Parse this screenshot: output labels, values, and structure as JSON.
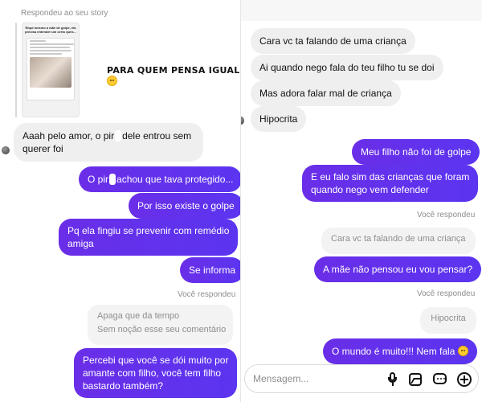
{
  "left": {
    "story_reply_label": "Respondeu ao seu story",
    "story_caption": "Riqui mesmo a mãe de golpe, ela precisa entender um certo ques...",
    "story_overlay_text": "PARA QUEM PENSA IGUAL",
    "messages": [
      {
        "id": "m1",
        "side": "in",
        "parts": [
          "Aaah pelo amor, o pir",
          "dele entrou sem",
          "querer foi"
        ]
      },
      {
        "id": "m2",
        "side": "out",
        "parts": [
          "O pir",
          "achou que tava protegido..."
        ]
      },
      {
        "id": "m3",
        "side": "out",
        "text": "Por isso existe o golpe"
      },
      {
        "id": "m4",
        "side": "out",
        "lines": [
          "Pq ela fingiu se prevenir com remédio",
          "amiga"
        ]
      },
      {
        "id": "m5",
        "side": "out",
        "text": "Se informa"
      }
    ],
    "you_replied_label": "Você respondeu",
    "quoted_reply": {
      "lines": [
        "Apaga que da tempo",
        "Sem noção esse seu comentário"
      ]
    },
    "last_message": {
      "lines": [
        "Percebi que você se dói muito por",
        "amante com filho, você tem filho",
        "bastardo também?"
      ]
    }
  },
  "right": {
    "incoming": [
      "Cara vc ta falando de uma criança",
      "Ai quando nego fala do teu filho tu se doi",
      "Mas adora falar mal de criança",
      "Hipocrita"
    ],
    "outgoing_1": "Meu filho não foi de golpe",
    "outgoing_2": [
      "E eu falo sim das crianças que foram",
      "quando nego vem defender"
    ],
    "you_replied_label_1": "Você respondeu",
    "quoted_1": "Cara vc ta falando de uma criança",
    "outgoing_3": "A mãe não pensou eu vou pensar?",
    "you_replied_label_2": "Você respondeu",
    "quoted_2": "Hipocrita",
    "outgoing_4": "O mundo é muito!!! Nem fala",
    "composer_placeholder": "Mensagem...",
    "icons": [
      "microphone-icon",
      "image-icon",
      "sticker-icon",
      "plus-icon",
      "smiley-emoji"
    ]
  },
  "colors": {
    "outgoing_bubble": "#6a2ee8",
    "incoming_bubble": "#efefef",
    "meta_text": "#8e8e8e"
  }
}
